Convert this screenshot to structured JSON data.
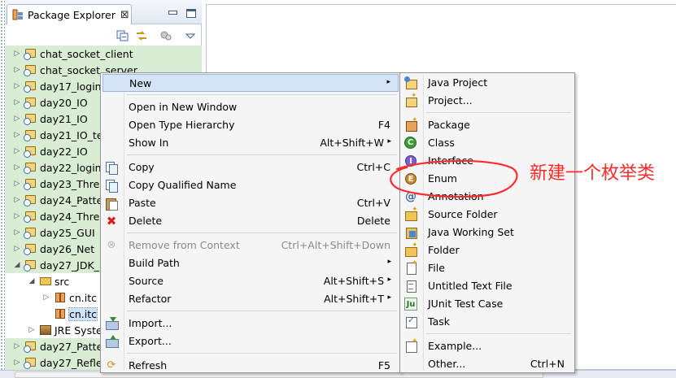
{
  "view": {
    "tab_title": "Package Explorer",
    "tab_close": "⊠"
  },
  "tree": [
    {
      "label": "chat_socket_client",
      "twisty": "▷",
      "icon": "java-project-icon",
      "highlight": true
    },
    {
      "label": "chat_socket_server",
      "twisty": "▷",
      "icon": "java-project-icon",
      "highlight": true
    },
    {
      "label": "day17_login",
      "twisty": "▷",
      "icon": "java-project-icon",
      "highlight": true
    },
    {
      "label": "day20_IO",
      "twisty": "▷",
      "icon": "java-project-icon",
      "highlight": true
    },
    {
      "label": "day21_IO",
      "twisty": "▷",
      "icon": "java-project-icon",
      "highlight": true
    },
    {
      "label": "day21_IO_te",
      "twisty": "▷",
      "icon": "java-project-icon",
      "highlight": true
    },
    {
      "label": "day22_IO",
      "twisty": "▷",
      "icon": "java-project-icon",
      "highlight": true
    },
    {
      "label": "day22_login",
      "twisty": "▷",
      "icon": "java-project-icon",
      "highlight": true
    },
    {
      "label": "day23_Threa",
      "twisty": "▷",
      "icon": "java-project-icon",
      "highlight": true
    },
    {
      "label": "day24_Patte",
      "twisty": "▷",
      "icon": "java-project-icon",
      "highlight": true
    },
    {
      "label": "day24_Threa",
      "twisty": "▷",
      "icon": "java-project-icon",
      "highlight": true
    },
    {
      "label": "day25_GUI",
      "twisty": "▷",
      "icon": "java-project-icon",
      "highlight": true
    },
    {
      "label": "day26_Net",
      "twisty": "▷",
      "icon": "java-project-icon",
      "highlight": true
    },
    {
      "label": "day27_JDK_",
      "twisty": "◢",
      "icon": "java-project-icon",
      "highlight": true
    },
    {
      "label": "src",
      "twisty": "◢",
      "icon": "source-folder-icon",
      "highlight": false
    },
    {
      "label": "cn.itc",
      "twisty": "▷",
      "icon": "package-icon",
      "highlight": false
    },
    {
      "label": "cn.itc",
      "twisty": "",
      "icon": "package-icon",
      "highlight": false,
      "selected": true
    },
    {
      "label": "JRE Syste",
      "twisty": "▷",
      "icon": "jre-library-icon",
      "highlight": false
    },
    {
      "label": "day27_Patte",
      "twisty": "▷",
      "icon": "java-project-icon",
      "highlight": true
    },
    {
      "label": "day27_Refle",
      "twisty": "▷",
      "icon": "java-project-icon",
      "highlight": true
    }
  ],
  "context_menu": {
    "items": [
      {
        "label": "New",
        "accel": "",
        "arrow": "▸",
        "icon": "",
        "hover": true
      },
      {
        "sep": true
      },
      {
        "label": "Open in New Window",
        "accel": "",
        "icon": ""
      },
      {
        "label": "Open Type Hierarchy",
        "accel": "F4",
        "icon": ""
      },
      {
        "label": "Show In",
        "accel": "Alt+Shift+W",
        "arrow": "▸",
        "icon": ""
      },
      {
        "sep": true
      },
      {
        "label": "Copy",
        "accel": "Ctrl+C",
        "icon": "copy-icon"
      },
      {
        "label": "Copy Qualified Name",
        "accel": "",
        "icon": "copy-icon"
      },
      {
        "label": "Paste",
        "accel": "Ctrl+V",
        "icon": "paste-icon"
      },
      {
        "label": "Delete",
        "accel": "Delete",
        "icon": "delete-icon"
      },
      {
        "sep": true
      },
      {
        "label": "Remove from Context",
        "accel": "Ctrl+Alt+Shift+Down",
        "icon": "remove-context-icon",
        "disabled": true
      },
      {
        "label": "Build Path",
        "accel": "",
        "arrow": "▸",
        "icon": ""
      },
      {
        "label": "Source",
        "accel": "Alt+Shift+S",
        "arrow": "▸",
        "icon": ""
      },
      {
        "label": "Refactor",
        "accel": "Alt+Shift+T",
        "arrow": "▸",
        "icon": ""
      },
      {
        "sep": true
      },
      {
        "label": "Import...",
        "accel": "",
        "icon": "import-icon"
      },
      {
        "label": "Export...",
        "accel": "",
        "icon": "export-icon"
      },
      {
        "sep": true
      },
      {
        "label": "Refresh",
        "accel": "F5",
        "icon": "refresh-icon"
      }
    ]
  },
  "submenu": {
    "items": [
      {
        "label": "Java Project",
        "icon": "java-project-new-icon"
      },
      {
        "label": "Project...",
        "icon": "project-new-icon"
      },
      {
        "sep": true
      },
      {
        "label": "Package",
        "icon": "package-new-icon"
      },
      {
        "label": "Class",
        "icon": "class-icon",
        "glyph": "C"
      },
      {
        "label": "Interface",
        "icon": "interface-icon",
        "glyph": "I"
      },
      {
        "label": "Enum",
        "icon": "enum-icon",
        "glyph": "E"
      },
      {
        "label": "Annotation",
        "icon": "annotation-icon",
        "glyph": "@"
      },
      {
        "label": "Source Folder",
        "icon": "source-folder-new-icon"
      },
      {
        "label": "Java Working Set",
        "icon": "working-set-icon"
      },
      {
        "label": "Folder",
        "icon": "folder-new-icon"
      },
      {
        "label": "File",
        "icon": "file-new-icon"
      },
      {
        "label": "Untitled Text File",
        "icon": "text-file-icon"
      },
      {
        "label": "JUnit Test Case",
        "icon": "junit-icon",
        "glyph": "Ju"
      },
      {
        "label": "Task",
        "icon": "task-icon"
      },
      {
        "sep": true
      },
      {
        "label": "Example...",
        "icon": "example-icon"
      },
      {
        "label": "Other...",
        "accel": "Ctrl+N",
        "icon": ""
      }
    ]
  },
  "annotation": {
    "text": "新建一个枚举类",
    "color": "#ff2a2a"
  },
  "colors": {
    "tree_highlight": "#d9ecd4",
    "menu_bg": "#f5f5f5",
    "menu_hover": "#d4e3f5"
  }
}
